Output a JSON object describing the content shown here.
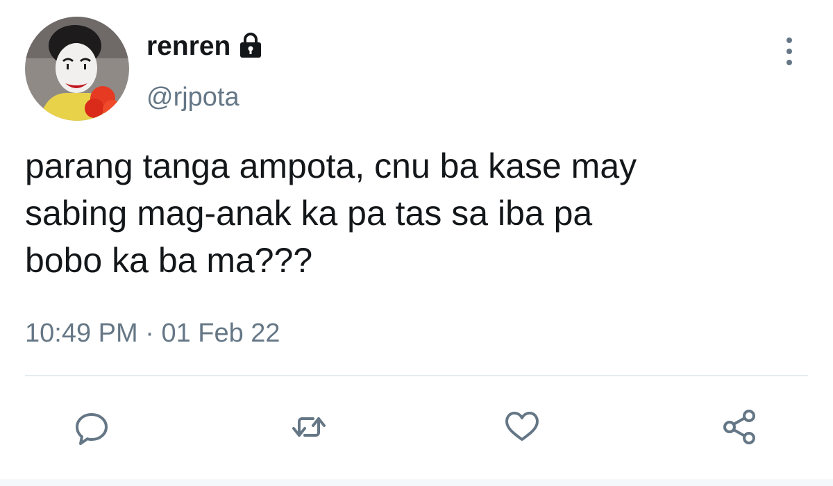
{
  "tweet": {
    "display_name": "renren",
    "handle": "@rjpota",
    "text": "parang tanga ampota, cnu ba kase may\nsabing mag-anak ka pa tas sa iba pa\nbobo ka ba ma???",
    "time": "10:49 PM",
    "separator": "·",
    "date": "01 Feb 22",
    "locked": true
  },
  "icons": {
    "lock": "lock-icon",
    "more": "more-vertical-icon",
    "reply": "reply-icon",
    "retweet": "retweet-icon",
    "like": "heart-icon",
    "share": "share-icon"
  },
  "colors": {
    "text": "#14171a",
    "secondary": "#657786",
    "divider": "#e6ecf0",
    "icon": "#657786"
  }
}
